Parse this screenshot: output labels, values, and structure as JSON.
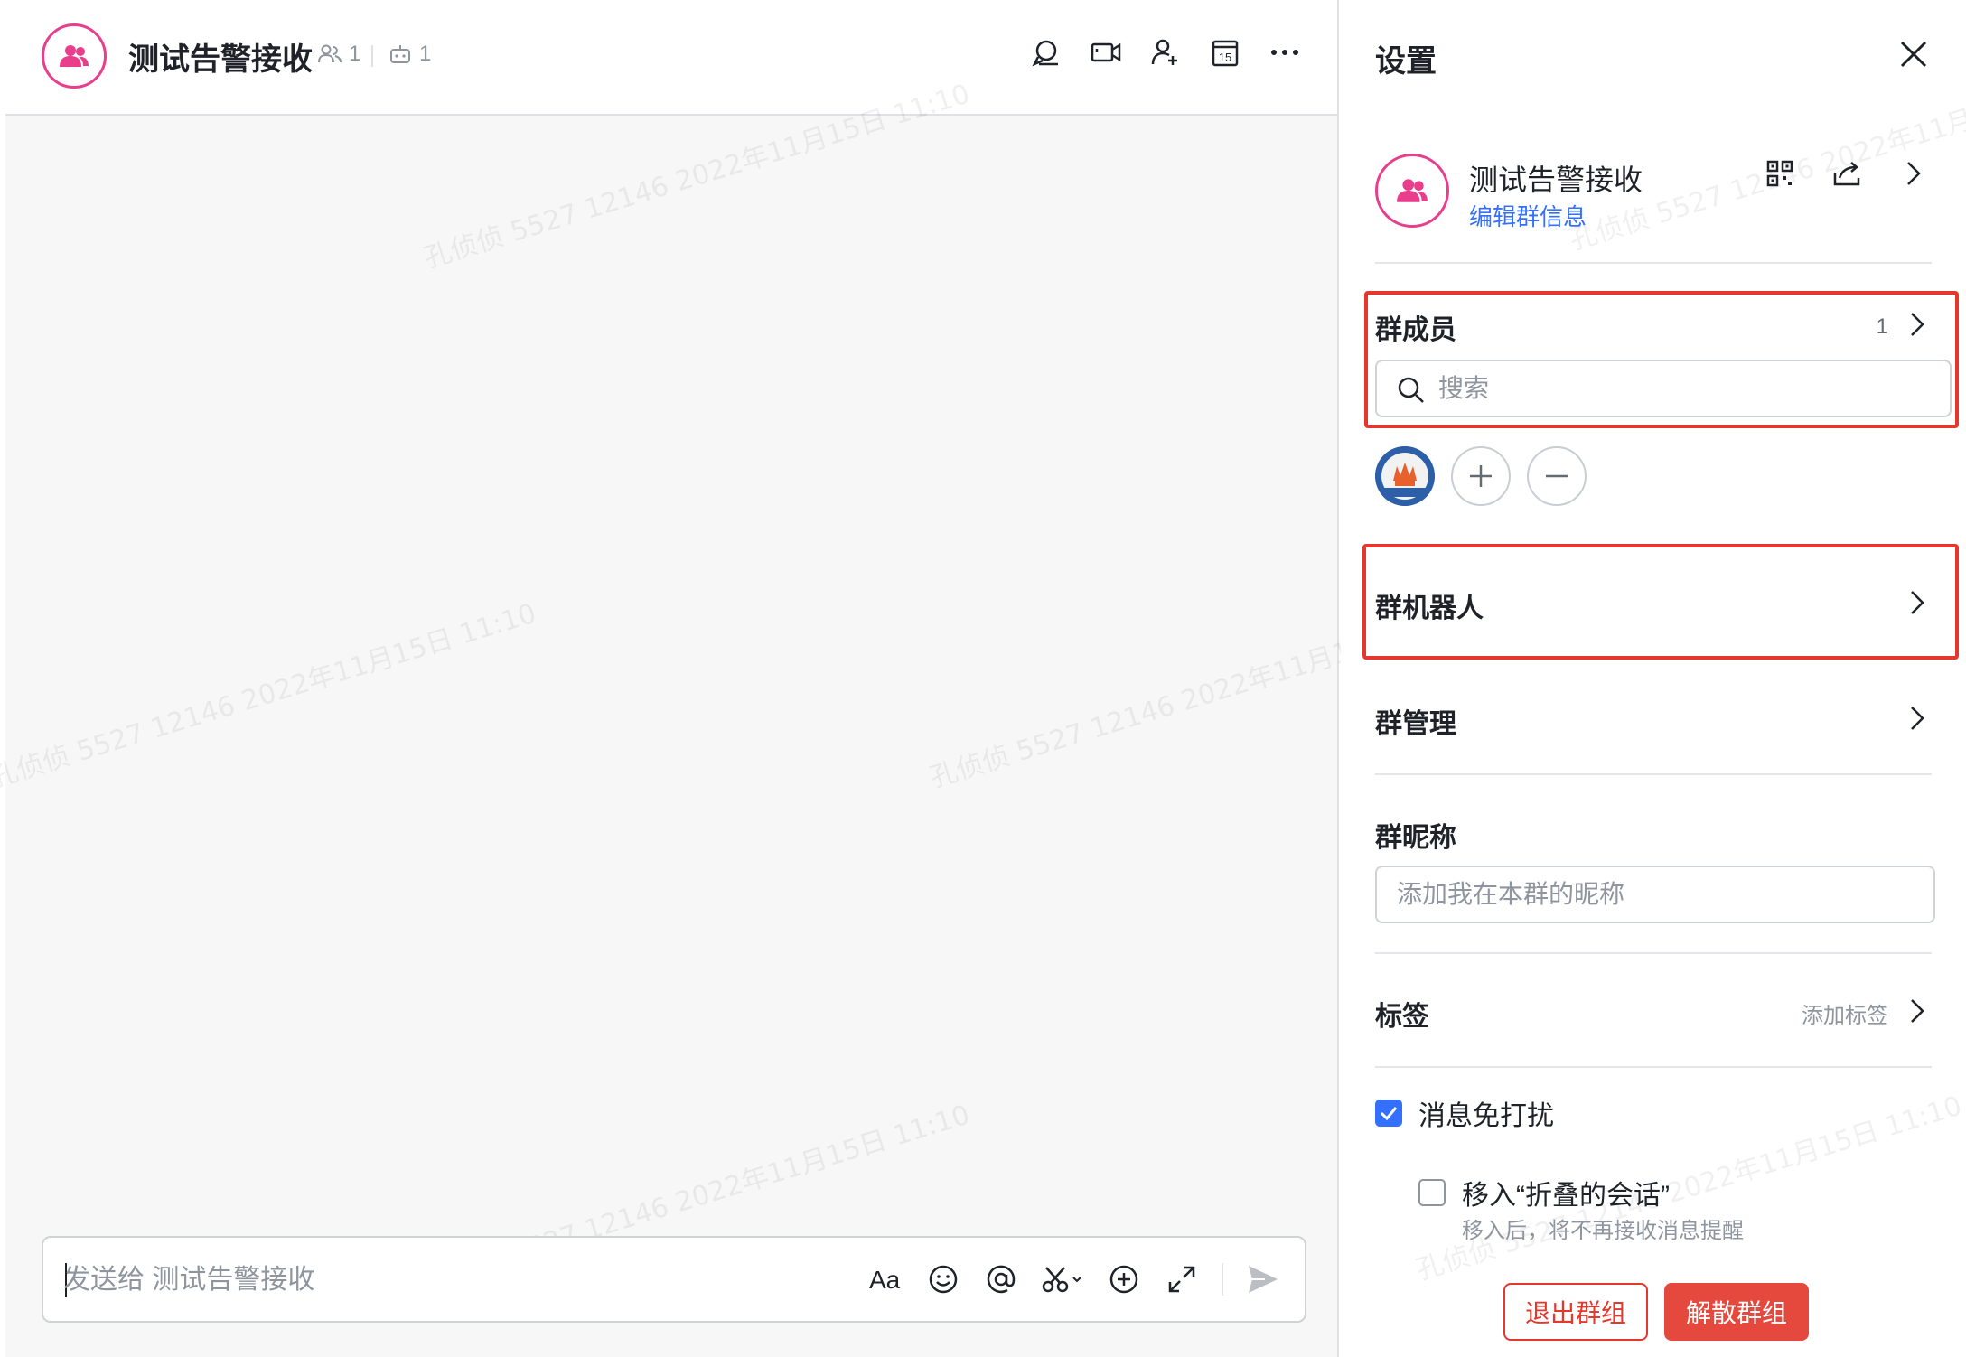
{
  "chat": {
    "title": "测试告警接收",
    "member_count": "1",
    "bot_count": "1",
    "composer_placeholder": "发送给 测试告警接收",
    "watermark": "孔侦侦 5527 12146 2022年11月15日 11:10"
  },
  "header_icons": [
    "search-chat-icon",
    "video-call-icon",
    "add-member-icon",
    "calendar-icon",
    "more-icon"
  ],
  "calendar_day": "15",
  "composer_tools": [
    "text-format-icon",
    "emoji-icon",
    "mention-icon",
    "screenshot-icon",
    "add-icon",
    "expand-icon",
    "send-icon"
  ],
  "text_format_label": "Aa",
  "settings": {
    "title": "设置",
    "group_name": "测试告警接收",
    "edit_info": "编辑群信息",
    "members": {
      "title": "群成员",
      "count": "1",
      "search_placeholder": "搜索"
    },
    "bots": {
      "title": "群机器人"
    },
    "management": {
      "title": "群管理"
    },
    "nickname": {
      "title": "群昵称",
      "placeholder": "添加我在本群的昵称"
    },
    "tags": {
      "title": "标签",
      "hint": "添加标签"
    },
    "mute": {
      "label": "消息免打扰",
      "checked": true
    },
    "fold": {
      "label": "移入“折叠的会话”",
      "sub": "移入后，将不再接收消息提醒",
      "checked": false
    },
    "leave_button": "退出群组",
    "dissolve_button": "解散群组"
  },
  "colors": {
    "accent": "#3370ff",
    "danger": "#e5372c",
    "avatar_ring": "#e83e8c"
  }
}
